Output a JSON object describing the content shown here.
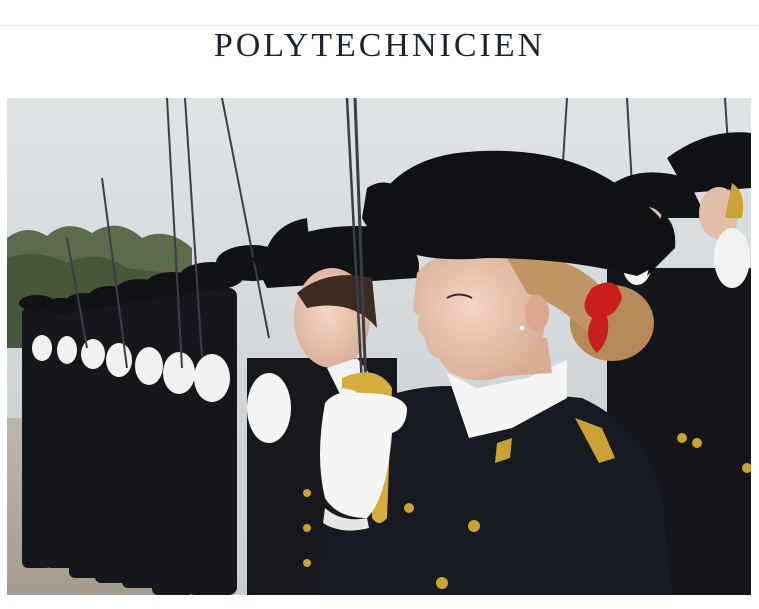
{
  "header": {
    "title": "POLYTECHNICIEN"
  },
  "hero_image": {
    "subject": "photo-of-cadets-in-bicorne-hats-holding-sabres",
    "colors": {
      "sky": "#d5d9dc",
      "uniform": "#14161c",
      "glove": "#f4f4f4",
      "gold": "#c9a233",
      "skin": "#e9c8b4",
      "ribbon": "#c81e1e"
    }
  }
}
